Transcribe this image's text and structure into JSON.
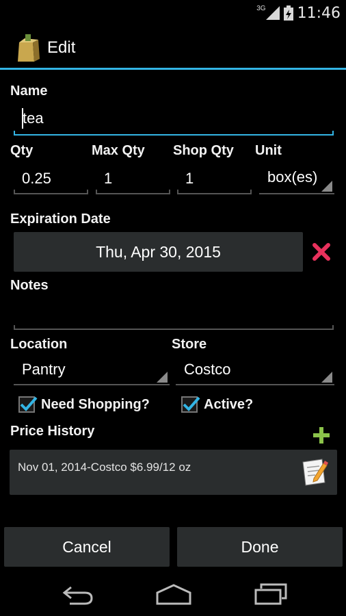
{
  "status_bar": {
    "time": "11:46",
    "network": "3G"
  },
  "header": {
    "title": "Edit",
    "icon": "grocery-bag-icon"
  },
  "form": {
    "name_label": "Name",
    "name_value": "tea",
    "qty_label": "Qty",
    "qty_value": "0.25",
    "max_qty_label": "Max Qty",
    "max_qty_value": "1",
    "shop_qty_label": "Shop Qty",
    "shop_qty_value": "1",
    "unit_label": "Unit",
    "unit_value": "box(es)",
    "expiration_label": "Expiration Date",
    "expiration_value": "Thu, Apr 30, 2015",
    "notes_label": "Notes",
    "notes_value": "",
    "location_label": "Location",
    "location_value": "Pantry",
    "store_label": "Store",
    "store_value": "Costco",
    "need_shopping_label": "Need Shopping?",
    "need_shopping_checked": true,
    "active_label": "Active?",
    "active_checked": true,
    "price_history_label": "Price History",
    "price_history": [
      {
        "entry": "Nov 01, 2014-Costco $6.99/12 oz"
      }
    ]
  },
  "actions": {
    "cancel_label": "Cancel",
    "done_label": "Done"
  },
  "colors": {
    "accent": "#33b5e5",
    "delete": "#e8315c",
    "add": "#8bc34a",
    "button_bg": "#2a2d2e"
  }
}
